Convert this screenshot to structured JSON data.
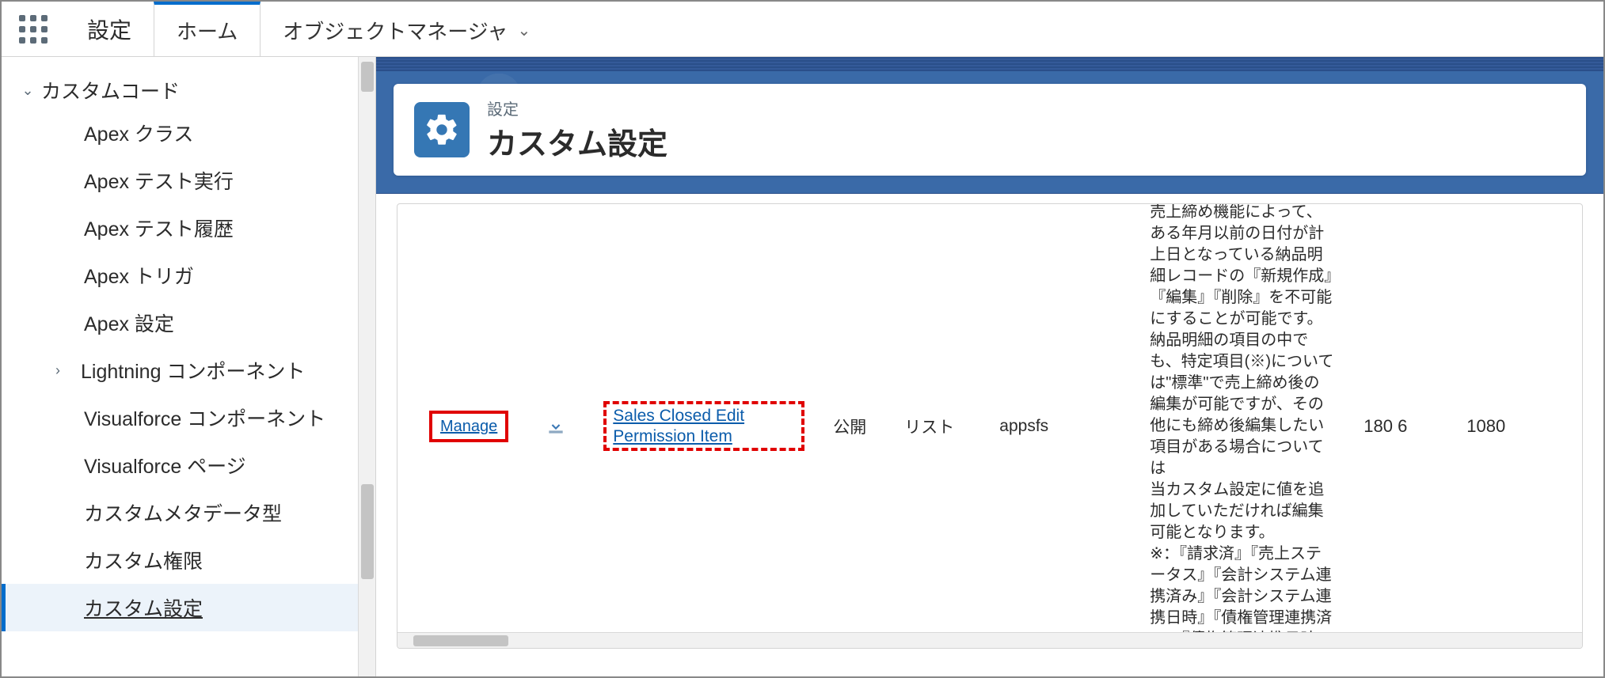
{
  "topbar": {
    "app_name": "設定",
    "tabs": [
      {
        "label": "ホーム",
        "active": true
      },
      {
        "label": "オブジェクトマネージャ",
        "active": false,
        "dropdown": true
      }
    ]
  },
  "sidebar": {
    "section": {
      "label": "カスタムコード",
      "expanded": true
    },
    "items": [
      {
        "label": "Apex クラス"
      },
      {
        "label": "Apex テスト実行"
      },
      {
        "label": "Apex テスト履歴"
      },
      {
        "label": "Apex トリガ"
      },
      {
        "label": "Apex 設定"
      },
      {
        "label": "Lightning コンポーネント",
        "expandable": true
      },
      {
        "label": "Visualforce コンポーネント"
      },
      {
        "label": "Visualforce ページ"
      },
      {
        "label": "カスタムメタデータ型"
      },
      {
        "label": "カスタム権限"
      },
      {
        "label": "カスタム設定",
        "selected": true
      }
    ]
  },
  "hero": {
    "breadcrumb": "設定",
    "title": "カスタム設定"
  },
  "row": {
    "action_label": "Manage",
    "name": "Sales Closed Edit Permission Item",
    "visibility": "公開",
    "type": "リスト",
    "namespace": "appsfs",
    "description": "売上締め機能によって、ある年月以前の日付が計上日となっている納品明細レコードの『新規作成』『編集』『削除』を不可能にすることが可能です。\n納品明細の項目の中でも、特定項目(※)については\"標準\"で売上締め後の編集が可能ですが、その他にも締め後編集したい項目がある場合については\n当カスタム設定に値を追加していただければ編集可能となります。\n※：『請求済』『売上ステータス』『会計システム連携済み』『会計システム連携日時』『債権管理連携済み』『債権管理連携日時』",
    "value1": "180 6",
    "value2": "1080"
  }
}
